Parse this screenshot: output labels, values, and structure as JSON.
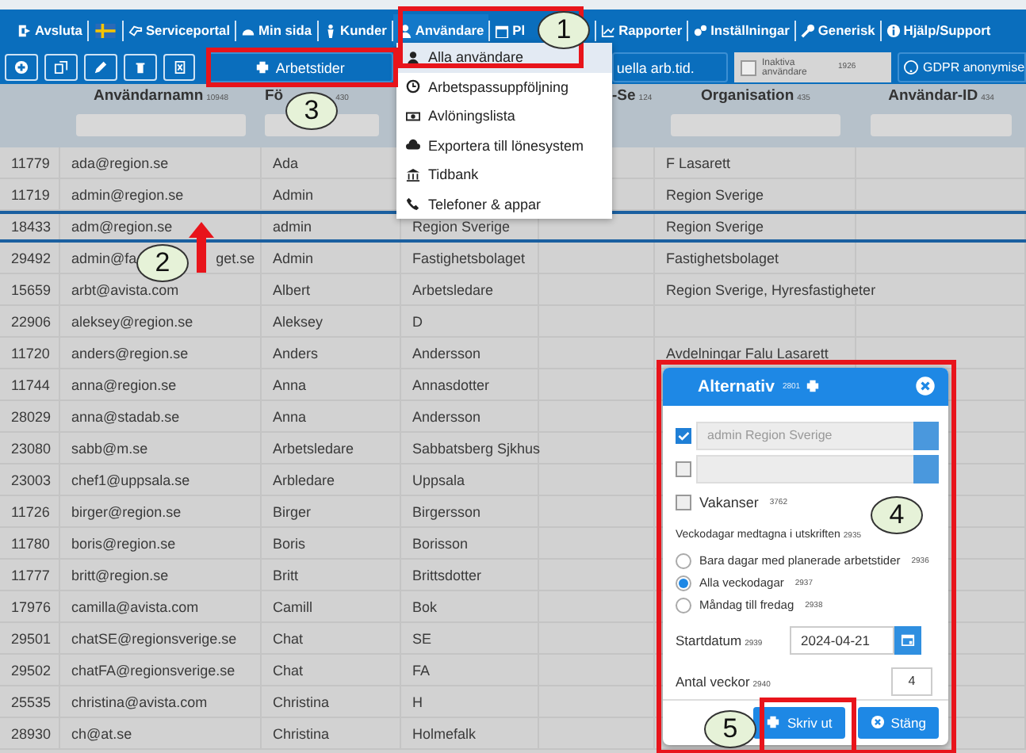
{
  "nav": [
    {
      "kind": "item",
      "label": "Avsluta",
      "selected": false
    },
    {
      "kind": "flag"
    },
    {
      "kind": "item",
      "label": "Serviceportal",
      "selected": false
    },
    {
      "kind": "item",
      "label": "Min sida",
      "selected": false
    },
    {
      "kind": "item",
      "label": "Kunder",
      "selected": false
    },
    {
      "kind": "item",
      "label": "Användare",
      "selected": true
    },
    {
      "kind": "item",
      "label": "Pl",
      "selected": false
    },
    {
      "kind": "item",
      "label": "Rapporter",
      "selected": false
    },
    {
      "kind": "item",
      "label": "Inställningar",
      "selected": false
    },
    {
      "kind": "item",
      "label": "Generisk",
      "selected": false
    },
    {
      "kind": "item",
      "label": "Hjälp/Support",
      "selected": false
    }
  ],
  "toolbar": [
    {
      "kind": "icon"
    },
    {
      "kind": "icon"
    },
    {
      "kind": "icon"
    },
    {
      "kind": "icon"
    },
    {
      "kind": "icon"
    },
    {
      "kind": "button",
      "label": "Arbetstider"
    },
    {
      "kind": "button",
      "label": "uella arb.tid."
    },
    {
      "kind": "checkbox",
      "label": "Inaktiva användare",
      "code": "1926",
      "checked": false
    },
    {
      "kind": "button",
      "label": "GDPR anonymise"
    }
  ],
  "menu": {
    "items": [
      {
        "label": "Alla användare",
        "selected": true
      },
      {
        "label": "Arbetspassuppföljning",
        "selected": false
      },
      {
        "label": "Avlöningslista",
        "selected": false
      },
      {
        "label": "Exportera till lönesystem",
        "selected": false
      },
      {
        "label": "Tidbank",
        "selected": false
      },
      {
        "label": "Telefoner & appar",
        "selected": false
      }
    ]
  },
  "table": {
    "columns": [
      null,
      {
        "label": "Användarnamn",
        "code": "10948"
      },
      {
        "label": "Fö",
        "code": "430"
      },
      null,
      {
        "label": "-Se",
        "code": "124"
      },
      {
        "label": "Organisation",
        "code": "435"
      },
      {
        "label": "Användar-ID",
        "code": "434"
      }
    ],
    "rows": [
      {
        "cells": [
          "11779",
          "ada@region.se",
          "Ada",
          null,
          null,
          "F Lasarett",
          null
        ],
        "selected": false
      },
      {
        "cells": [
          "11719",
          "admin@region.se",
          "Admin",
          null,
          null,
          "Region Sverige",
          null
        ],
        "selected": false
      },
      {
        "cells": [
          "18433",
          "adm@region.se",
          "admin",
          "Region Sverige",
          null,
          "Region Sverige",
          null
        ],
        "selected": true
      },
      {
        "cells": [
          "29492",
          [
            "admin@fa",
            "get.se"
          ],
          "Admin",
          "Fastighetsbolaget",
          null,
          "Fastighetsbolaget",
          null
        ],
        "selected": false
      },
      {
        "cells": [
          "15659",
          "arbt@avista.com",
          "Albert",
          "Arbetsledare",
          null,
          "Region Sverige, Hyresfastigheter",
          null
        ],
        "selected": false
      },
      {
        "cells": [
          "22906",
          "aleksey@region.se",
          "Aleksey",
          "D",
          null,
          null,
          null
        ],
        "selected": false
      },
      {
        "cells": [
          "11720",
          "anders@region.se",
          "Anders",
          "Andersson",
          null,
          "Avdelningar Falu Lasarett",
          null
        ],
        "selected": false
      },
      {
        "cells": [
          "11744",
          "anna@region.se",
          "Anna",
          "Annasdotter",
          null,
          null,
          null
        ],
        "selected": false
      },
      {
        "cells": [
          "28029",
          "anna@stadab.se",
          "Anna",
          "Andersson",
          null,
          null,
          null
        ],
        "selected": false
      },
      {
        "cells": [
          "23080",
          "sabb@m.se",
          "Arbetsledare",
          "Sabbatsberg Sjkhus",
          null,
          null,
          null
        ],
        "selected": false
      },
      {
        "cells": [
          "23003",
          "chef1@uppsala.se",
          "Arbledare",
          "Uppsala",
          null,
          null,
          null
        ],
        "selected": false
      },
      {
        "cells": [
          "11726",
          "birger@region.se",
          "Birger",
          "Birgersson",
          null,
          null,
          null
        ],
        "selected": false
      },
      {
        "cells": [
          "11780",
          "boris@region.se",
          "Boris",
          "Borisson",
          null,
          null,
          null
        ],
        "selected": false
      },
      {
        "cells": [
          "11777",
          "britt@region.se",
          "Britt",
          "Brittsdotter",
          null,
          null,
          null
        ],
        "selected": false
      },
      {
        "cells": [
          "17976",
          "camilla@avista.com",
          "Camill",
          "Bok",
          null,
          null,
          null
        ],
        "selected": false
      },
      {
        "cells": [
          "29501",
          "chatSE@regionsverige.se",
          "Chat",
          "SE",
          null,
          null,
          null
        ],
        "selected": false
      },
      {
        "cells": [
          "29502",
          "chatFA@regionsverige.se",
          "Chat",
          "FA",
          null,
          null,
          null
        ],
        "selected": false
      },
      {
        "cells": [
          "25535",
          "christina@avista.com",
          "Christina",
          "H",
          null,
          null,
          null
        ],
        "selected": false
      },
      {
        "cells": [
          "28930",
          "ch@at.se",
          "Christina",
          "Holmefalk",
          null,
          null,
          null
        ],
        "selected": false
      }
    ]
  },
  "dialog": {
    "title": "Alternativ",
    "code": "2801",
    "selects": [
      {
        "checked": true,
        "disabled": true,
        "value": "admin Region Sverige"
      },
      {
        "checked": false,
        "disabled": true
      }
    ],
    "vacancies": {
      "label": "Vakanser",
      "code": "3762",
      "checked": false
    },
    "weekdays_label": {
      "label": "Veckodagar medtagna i utskriften",
      "code": "2935"
    },
    "radios": [
      {
        "label": "Bara dagar med planerade arbetstider",
        "code": "2936",
        "selected": false
      },
      {
        "label": "Alla veckodagar",
        "code": "2937",
        "selected": true
      },
      {
        "label": "Måndag till fredag",
        "code": "2938",
        "selected": false
      }
    ],
    "start_date": {
      "label": "Startdatum",
      "code": "2939",
      "value": "2024-04-21"
    },
    "weeks": {
      "label": "Antal veckor",
      "code": "2940",
      "value": "4"
    },
    "buttons": [
      {
        "label": "Skriv ut"
      },
      {
        "label": "Stäng"
      }
    ]
  },
  "annotations": [
    {
      "label": "1"
    },
    {
      "label": "2"
    },
    {
      "label": "3"
    },
    {
      "label": "4"
    },
    {
      "label": "5"
    }
  ]
}
